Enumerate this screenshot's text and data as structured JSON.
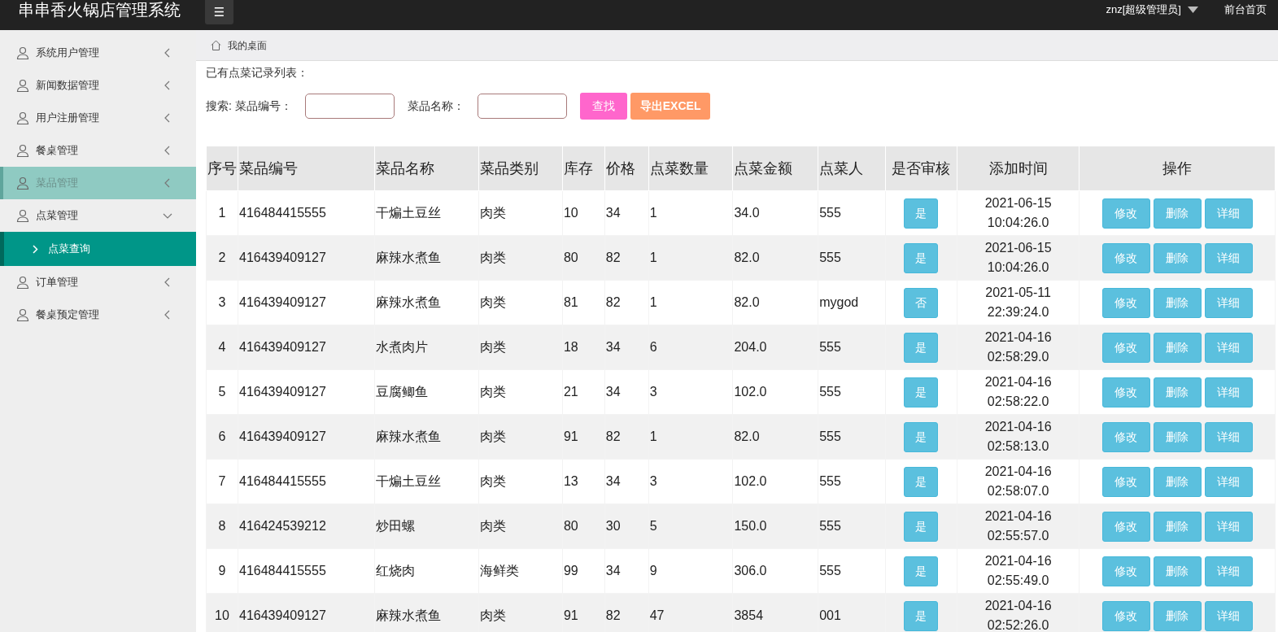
{
  "topbar": {
    "title": "串串香火锅店管理系统",
    "menu_icon": "☰",
    "user": "znz[超级管理员]",
    "home_link": "前台首页"
  },
  "sidebar": {
    "items": [
      {
        "label": "系统用户管理",
        "selected": false,
        "expanded": false
      },
      {
        "label": "新闻数据管理",
        "selected": false,
        "expanded": false
      },
      {
        "label": "用户注册管理",
        "selected": false,
        "expanded": false
      },
      {
        "label": "餐桌管理",
        "selected": false,
        "expanded": false
      },
      {
        "label": "菜品管理",
        "selected": true,
        "expanded": false
      },
      {
        "label": "点菜管理",
        "selected": false,
        "expanded": true,
        "children": [
          {
            "label": "点菜查询",
            "selected": true
          }
        ]
      },
      {
        "label": "订单管理",
        "selected": false,
        "expanded": false
      },
      {
        "label": "餐桌预定管理",
        "selected": false,
        "expanded": false
      }
    ]
  },
  "breadcrumb": "我的桌面",
  "list_title": "已有点菜记录列表：",
  "search": {
    "label": "搜索: 菜品编号：",
    "field2_label": "菜品名称：",
    "search_button": "查找",
    "export_button": "导出EXCEL"
  },
  "table": {
    "columns": [
      "序号",
      "菜品编号",
      "菜品名称",
      "菜品类别",
      "库存",
      "价格",
      "点菜数量",
      "点菜金额",
      "点菜人",
      "是否审核",
      "添加时间",
      "操作"
    ],
    "rows": [
      [
        "1",
        "416484415555",
        "干煸土豆丝",
        "肉类",
        "10",
        "34",
        "1",
        "34.0",
        "555",
        "是",
        "2021-06-15 10:04:26.0",
        [
          "修改",
          "删除",
          "详细"
        ]
      ],
      [
        "2",
        "416439409127",
        "麻辣水煮鱼",
        "肉类",
        "80",
        "82",
        "1",
        "82.0",
        "555",
        "是",
        "2021-06-15 10:04:26.0",
        [
          "修改",
          "删除",
          "详细"
        ]
      ],
      [
        "3",
        "416439409127",
        "麻辣水煮鱼",
        "肉类",
        "81",
        "82",
        "1",
        "82.0",
        "mygod",
        "否",
        "2021-05-11 22:39:24.0",
        [
          "修改",
          "删除",
          "详细"
        ]
      ],
      [
        "4",
        "416439409127",
        "水煮肉片",
        "肉类",
        "18",
        "34",
        "6",
        "204.0",
        "555",
        "是",
        "2021-04-16 02:58:29.0",
        [
          "修改",
          "删除",
          "详细"
        ]
      ],
      [
        "5",
        "416439409127",
        "豆腐鲫鱼",
        "肉类",
        "21",
        "34",
        "3",
        "102.0",
        "555",
        "是",
        "2021-04-16 02:58:22.0",
        [
          "修改",
          "删除",
          "详细"
        ]
      ],
      [
        "6",
        "416439409127",
        "麻辣水煮鱼",
        "肉类",
        "91",
        "82",
        "1",
        "82.0",
        "555",
        "是",
        "2021-04-16 02:58:13.0",
        [
          "修改",
          "删除",
          "详细"
        ]
      ],
      [
        "7",
        "416484415555",
        "干煸土豆丝",
        "肉类",
        "13",
        "34",
        "3",
        "102.0",
        "555",
        "是",
        "2021-04-16 02:58:07.0",
        [
          "修改",
          "删除",
          "详细"
        ]
      ],
      [
        "8",
        "416424539212",
        "炒田螺",
        "肉类",
        "80",
        "30",
        "5",
        "150.0",
        "555",
        "是",
        "2021-04-16 02:55:57.0",
        [
          "修改",
          "删除",
          "详细"
        ]
      ],
      [
        "9",
        "416484415555",
        "红烧肉",
        "海鲜类",
        "99",
        "34",
        "9",
        "306.0",
        "555",
        "是",
        "2021-04-16 02:55:49.0",
        [
          "修改",
          "删除",
          "详细"
        ]
      ],
      [
        "10",
        "416439409127",
        "麻辣水煮鱼",
        "肉类",
        "91",
        "82",
        "47",
        "3854",
        "001",
        "是",
        "2021-04-16 02:52:26.0",
        [
          "修改",
          "删除",
          "详细"
        ]
      ]
    ]
  }
}
